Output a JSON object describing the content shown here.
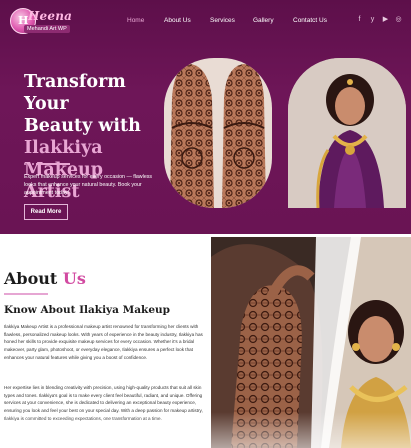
{
  "brand": {
    "logo_name": "Heena",
    "logo_tagline": "Mehandi Art WP",
    "logo_badge_letter": "H"
  },
  "nav": {
    "items": [
      {
        "label": "Home",
        "active": true
      },
      {
        "label": "About Us",
        "active": false
      },
      {
        "label": "Services",
        "active": false
      },
      {
        "label": "Gallery",
        "active": false
      },
      {
        "label": "Contatct Us",
        "active": false
      }
    ]
  },
  "social": {
    "icons": [
      "facebook-icon",
      "twitter-icon",
      "youtube-icon",
      "instagram-icon"
    ],
    "glyphs": [
      "f",
      "y",
      "▶",
      "◎"
    ]
  },
  "hero": {
    "title_line1": "Transform Your",
    "title_line2": "Beauty with",
    "title_accent": "Ilakkiya Makeup Artist",
    "description": "Expert makeup services for every occasion — flawless looks that enhance your natural beauty. Book your appointment today!",
    "cta_label": "Read More"
  },
  "about": {
    "title": "About",
    "title_accent": "Us",
    "subtitle": "Know About Ilakiya Makeup",
    "paragraph1": "Ilakkiya Makeup Artist is a professional makeup artist renowned for transforming her clients with flawless, personalized makeup looks. With years of experience in the beauty industry, Ilakkiya has honed her skills to provide exquisite makeup services for every occasion. Whether it's a bridal makeover, party glam, photoshoot, or everyday elegance, Ilakkiya ensures a perfect look that enhances your natural features while giving you a boost of confidence.",
    "paragraph2": "Her expertise lies in blending creativity with precision, using high-quality products that suit all skin types and tones. Ilakkiya's goal is to make every client feel beautiful, radiant, and unique. Offering services at your convenience, she is dedicated to delivering an exceptional beauty experience, ensuring you look and feel your best on your special day. With a deep passion for makeup artistry, Ilakkiya is committed to exceeding expectations, one transformation at a time."
  },
  "colors": {
    "hero_bg": "#6a1454",
    "accent_pink": "#e8a6d3",
    "about_accent": "#d24aa1"
  }
}
